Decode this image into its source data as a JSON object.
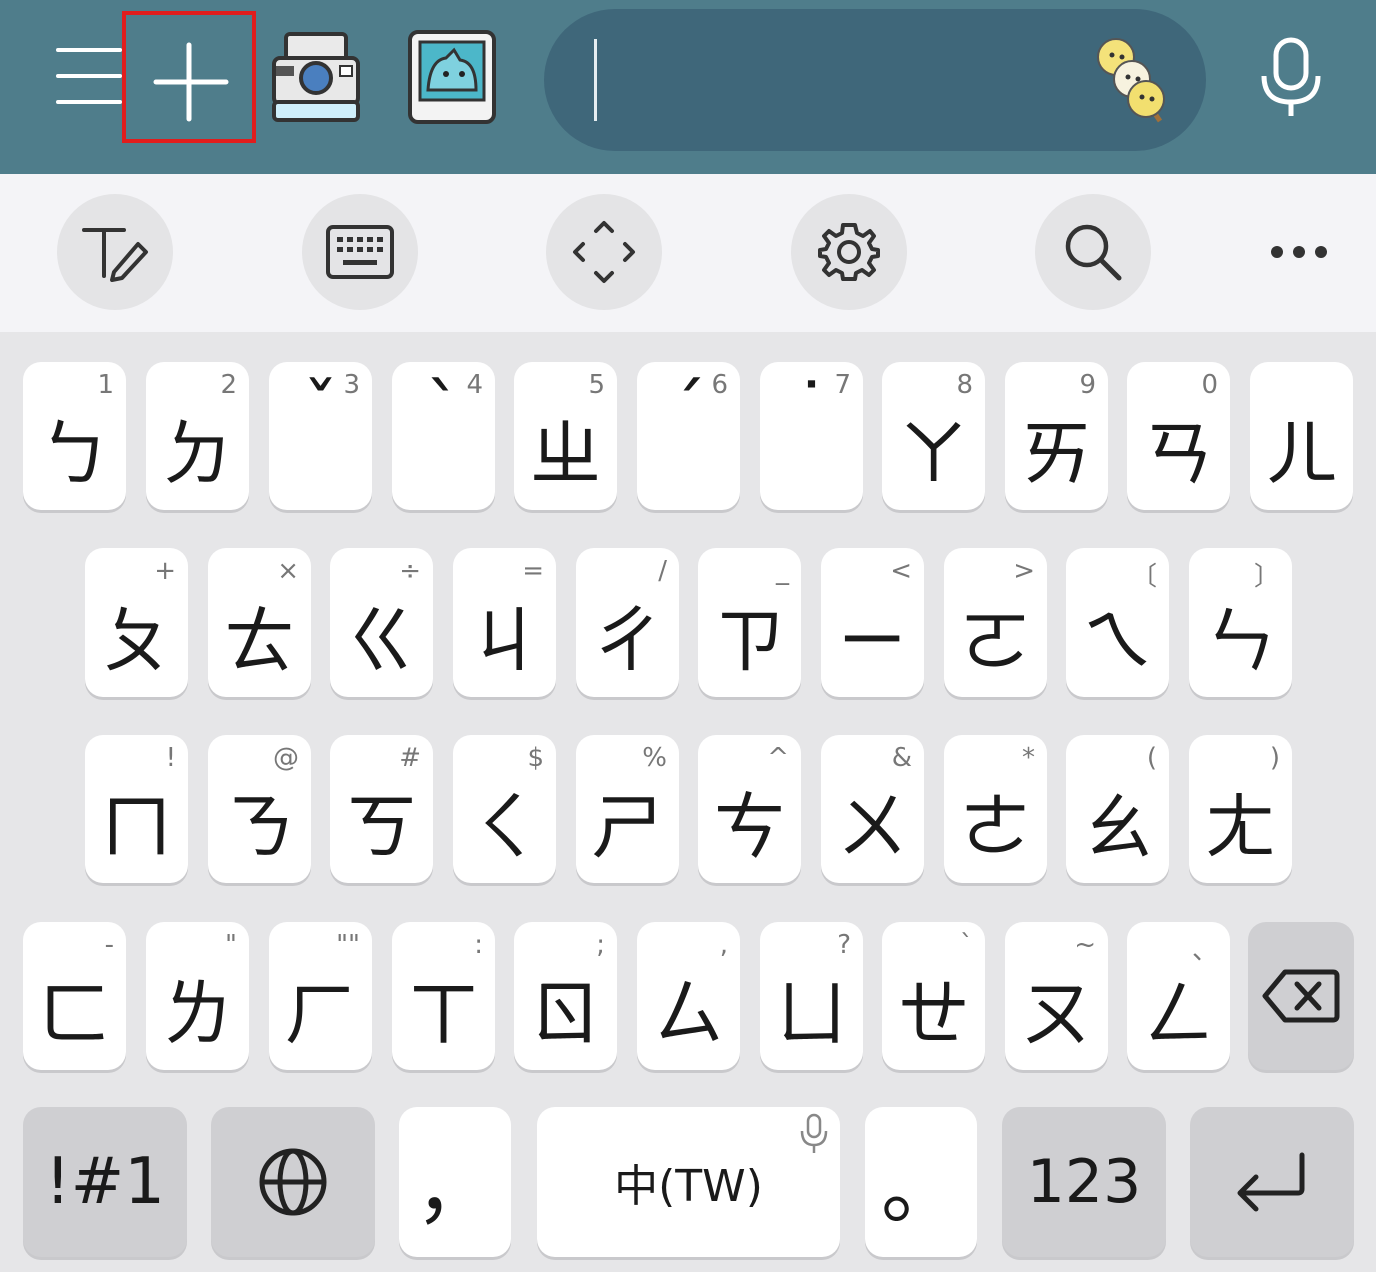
{
  "top_bar": {
    "input_value": "",
    "icons": [
      "menu-icon",
      "plus-icon",
      "camera-icon",
      "cat-sticker-icon",
      "dango-emoji-icon",
      "microphone-icon"
    ]
  },
  "toolbar": {
    "icons": [
      "handwriting-icon",
      "keyboard-icon",
      "move-icon",
      "settings-icon",
      "search-icon",
      "more-icon"
    ]
  },
  "keyboard": {
    "row1": [
      {
        "sup": "1",
        "main": "ㄅ"
      },
      {
        "sup": "2",
        "main": "ㄉ"
      },
      {
        "sup": "3",
        "main": "ˇ"
      },
      {
        "sup": "4",
        "main": "ˋ"
      },
      {
        "sup": "5",
        "main": "ㄓ"
      },
      {
        "sup": "6",
        "main": "ˊ"
      },
      {
        "sup": "7",
        "main": "˙"
      },
      {
        "sup": "8",
        "main": "ㄚ"
      },
      {
        "sup": "9",
        "main": "ㄞ"
      },
      {
        "sup": "0",
        "main": "ㄢ"
      },
      {
        "sup": "",
        "main": "ㄦ"
      }
    ],
    "row2": [
      {
        "sup": "+",
        "main": "ㄆ"
      },
      {
        "sup": "×",
        "main": "ㄊ"
      },
      {
        "sup": "÷",
        "main": "ㄍ"
      },
      {
        "sup": "=",
        "main": "ㄐ"
      },
      {
        "sup": "/",
        "main": "ㄔ"
      },
      {
        "sup": "_",
        "main": "ㄗ"
      },
      {
        "sup": "<",
        "main": "ㄧ"
      },
      {
        "sup": ">",
        "main": "ㄛ"
      },
      {
        "sup": "〔",
        "main": "ㄟ"
      },
      {
        "sup": "〕",
        "main": "ㄣ"
      }
    ],
    "row3": [
      {
        "sup": "!",
        "main": "ㄇ"
      },
      {
        "sup": "@",
        "main": "ㄋ"
      },
      {
        "sup": "#",
        "main": "ㄎ"
      },
      {
        "sup": "$",
        "main": "ㄑ"
      },
      {
        "sup": "%",
        "main": "ㄕ"
      },
      {
        "sup": "^",
        "main": "ㄘ"
      },
      {
        "sup": "&",
        "main": "ㄨ"
      },
      {
        "sup": "*",
        "main": "ㄜ"
      },
      {
        "sup": "(",
        "main": "ㄠ"
      },
      {
        "sup": ")",
        "main": "ㄤ"
      }
    ],
    "row4": [
      {
        "sup": "-",
        "main": "ㄈ"
      },
      {
        "sup": "\"",
        "main": "ㄌ"
      },
      {
        "sup": "\"\"",
        "main": "ㄏ"
      },
      {
        "sup": ":",
        "main": "ㄒ"
      },
      {
        "sup": ";",
        "main": "ㄖ"
      },
      {
        "sup": ",",
        "main": "ㄙ"
      },
      {
        "sup": "?",
        "main": "ㄩ"
      },
      {
        "sup": "`",
        "main": "ㄝ"
      },
      {
        "sup": "~",
        "main": "ㄡ"
      },
      {
        "sup": "、",
        "main": "ㄥ"
      }
    ],
    "bottom": {
      "symbols": "!#1",
      "comma": "，",
      "space": "中(TW)",
      "period": "。",
      "numbers": "123"
    }
  }
}
